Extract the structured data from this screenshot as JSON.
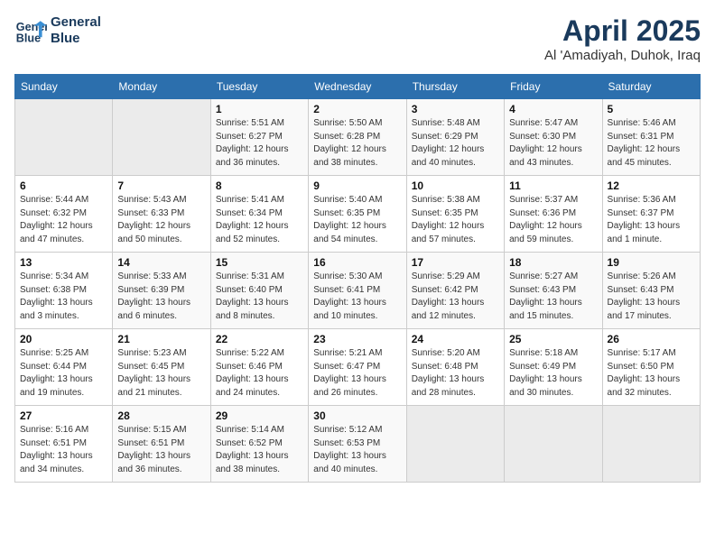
{
  "header": {
    "logo_line1": "General",
    "logo_line2": "Blue",
    "month_title": "April 2025",
    "location": "Al 'Amadiyah, Duhok, Iraq"
  },
  "weekdays": [
    "Sunday",
    "Monday",
    "Tuesday",
    "Wednesday",
    "Thursday",
    "Friday",
    "Saturday"
  ],
  "weeks": [
    [
      {
        "day": "",
        "info": ""
      },
      {
        "day": "",
        "info": ""
      },
      {
        "day": "1",
        "info": "Sunrise: 5:51 AM\nSunset: 6:27 PM\nDaylight: 12 hours\nand 36 minutes."
      },
      {
        "day": "2",
        "info": "Sunrise: 5:50 AM\nSunset: 6:28 PM\nDaylight: 12 hours\nand 38 minutes."
      },
      {
        "day": "3",
        "info": "Sunrise: 5:48 AM\nSunset: 6:29 PM\nDaylight: 12 hours\nand 40 minutes."
      },
      {
        "day": "4",
        "info": "Sunrise: 5:47 AM\nSunset: 6:30 PM\nDaylight: 12 hours\nand 43 minutes."
      },
      {
        "day": "5",
        "info": "Sunrise: 5:46 AM\nSunset: 6:31 PM\nDaylight: 12 hours\nand 45 minutes."
      }
    ],
    [
      {
        "day": "6",
        "info": "Sunrise: 5:44 AM\nSunset: 6:32 PM\nDaylight: 12 hours\nand 47 minutes."
      },
      {
        "day": "7",
        "info": "Sunrise: 5:43 AM\nSunset: 6:33 PM\nDaylight: 12 hours\nand 50 minutes."
      },
      {
        "day": "8",
        "info": "Sunrise: 5:41 AM\nSunset: 6:34 PM\nDaylight: 12 hours\nand 52 minutes."
      },
      {
        "day": "9",
        "info": "Sunrise: 5:40 AM\nSunset: 6:35 PM\nDaylight: 12 hours\nand 54 minutes."
      },
      {
        "day": "10",
        "info": "Sunrise: 5:38 AM\nSunset: 6:35 PM\nDaylight: 12 hours\nand 57 minutes."
      },
      {
        "day": "11",
        "info": "Sunrise: 5:37 AM\nSunset: 6:36 PM\nDaylight: 12 hours\nand 59 minutes."
      },
      {
        "day": "12",
        "info": "Sunrise: 5:36 AM\nSunset: 6:37 PM\nDaylight: 13 hours\nand 1 minute."
      }
    ],
    [
      {
        "day": "13",
        "info": "Sunrise: 5:34 AM\nSunset: 6:38 PM\nDaylight: 13 hours\nand 3 minutes."
      },
      {
        "day": "14",
        "info": "Sunrise: 5:33 AM\nSunset: 6:39 PM\nDaylight: 13 hours\nand 6 minutes."
      },
      {
        "day": "15",
        "info": "Sunrise: 5:31 AM\nSunset: 6:40 PM\nDaylight: 13 hours\nand 8 minutes."
      },
      {
        "day": "16",
        "info": "Sunrise: 5:30 AM\nSunset: 6:41 PM\nDaylight: 13 hours\nand 10 minutes."
      },
      {
        "day": "17",
        "info": "Sunrise: 5:29 AM\nSunset: 6:42 PM\nDaylight: 13 hours\nand 12 minutes."
      },
      {
        "day": "18",
        "info": "Sunrise: 5:27 AM\nSunset: 6:43 PM\nDaylight: 13 hours\nand 15 minutes."
      },
      {
        "day": "19",
        "info": "Sunrise: 5:26 AM\nSunset: 6:43 PM\nDaylight: 13 hours\nand 17 minutes."
      }
    ],
    [
      {
        "day": "20",
        "info": "Sunrise: 5:25 AM\nSunset: 6:44 PM\nDaylight: 13 hours\nand 19 minutes."
      },
      {
        "day": "21",
        "info": "Sunrise: 5:23 AM\nSunset: 6:45 PM\nDaylight: 13 hours\nand 21 minutes."
      },
      {
        "day": "22",
        "info": "Sunrise: 5:22 AM\nSunset: 6:46 PM\nDaylight: 13 hours\nand 24 minutes."
      },
      {
        "day": "23",
        "info": "Sunrise: 5:21 AM\nSunset: 6:47 PM\nDaylight: 13 hours\nand 26 minutes."
      },
      {
        "day": "24",
        "info": "Sunrise: 5:20 AM\nSunset: 6:48 PM\nDaylight: 13 hours\nand 28 minutes."
      },
      {
        "day": "25",
        "info": "Sunrise: 5:18 AM\nSunset: 6:49 PM\nDaylight: 13 hours\nand 30 minutes."
      },
      {
        "day": "26",
        "info": "Sunrise: 5:17 AM\nSunset: 6:50 PM\nDaylight: 13 hours\nand 32 minutes."
      }
    ],
    [
      {
        "day": "27",
        "info": "Sunrise: 5:16 AM\nSunset: 6:51 PM\nDaylight: 13 hours\nand 34 minutes."
      },
      {
        "day": "28",
        "info": "Sunrise: 5:15 AM\nSunset: 6:51 PM\nDaylight: 13 hours\nand 36 minutes."
      },
      {
        "day": "29",
        "info": "Sunrise: 5:14 AM\nSunset: 6:52 PM\nDaylight: 13 hours\nand 38 minutes."
      },
      {
        "day": "30",
        "info": "Sunrise: 5:12 AM\nSunset: 6:53 PM\nDaylight: 13 hours\nand 40 minutes."
      },
      {
        "day": "",
        "info": ""
      },
      {
        "day": "",
        "info": ""
      },
      {
        "day": "",
        "info": ""
      }
    ]
  ]
}
